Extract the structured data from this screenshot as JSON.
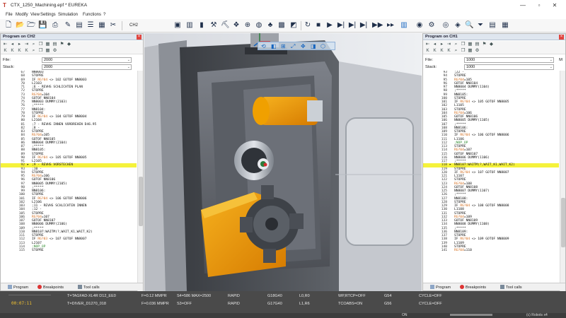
{
  "window": {
    "title": "CTX_1250_Machining.epf * EUREKA",
    "minimize": "—",
    "maximize": "▫",
    "close": "✕"
  },
  "menu": [
    "File",
    "Modify",
    "View",
    "Settings",
    "Simulation",
    "Functions",
    "?"
  ],
  "toolbar": {
    "channel_label": "CH2"
  },
  "left_panel": {
    "title": "Program on CH2",
    "file_label": "File:",
    "file_value": "2000",
    "stack_label": "Stack:",
    "stack_value": "2000",
    "lines": [
      {
        "n": "67",
        "t": "NN8003"
      },
      {
        "n": "68",
        "t": "STOPRE"
      },
      {
        "n": "69",
        "t": "IF RG?04 <> 102 GOTOF NN8003"
      },
      {
        "n": "70",
        "t": "L2103"
      },
      {
        "n": "71",
        "t": ";6 - REVHS SCHLICHTEN PLAN"
      },
      {
        "n": "72",
        "t": "STOPRE"
      },
      {
        "n": "73",
        "t": "RG?04=104"
      },
      {
        "n": "74",
        "t": "GOTOF NN8104"
      },
      {
        "n": "75",
        "t": "NN8003 DUMMY(2103)"
      },
      {
        "n": "76",
        "t": ";*****"
      },
      {
        "n": "77",
        "t": "NN8104:"
      },
      {
        "n": "78",
        "t": "STOPRE"
      },
      {
        "n": "79",
        "t": "IF RG?04 <> 104 GOTOF NN8004"
      },
      {
        "n": "80",
        "t": "L2104"
      },
      {
        "n": "81",
        "t": ";7 - REVHS INNEN VORDREHEN D46.95"
      },
      {
        "n": "82",
        "t": ";8 -"
      },
      {
        "n": "83",
        "t": "STOPRE"
      },
      {
        "n": "84",
        "t": "RG?04=105"
      },
      {
        "n": "85",
        "t": "GOTOF NN8105"
      },
      {
        "n": "86",
        "t": "NN8004 DUMMY(2104)"
      },
      {
        "n": "87",
        "t": ";*****"
      },
      {
        "n": "88",
        "t": "NN8105:"
      },
      {
        "n": "89",
        "t": "STOPRE"
      },
      {
        "n": "90",
        "t": "IF RG?04 <> 105 GOTOF NN8005"
      },
      {
        "n": "91",
        "t": "L2105"
      },
      {
        "n": "92",
        "t": ";9 - REVHS VORSTECHEN",
        "hl": true
      },
      {
        "n": "93",
        "t": ";10 -"
      },
      {
        "n": "94",
        "t": "STOPRE"
      },
      {
        "n": "95",
        "t": "RG?04=106"
      },
      {
        "n": "96",
        "t": "GOTOF NN8106"
      },
      {
        "n": "97",
        "t": "NN8005 DUMMY(2105)"
      },
      {
        "n": "98",
        "t": ";*****"
      },
      {
        "n": "99",
        "t": "NN8106:"
      },
      {
        "n": "100",
        "t": "STOPRE"
      },
      {
        "n": "101",
        "t": "IF RG?04 <> 106 GOTOF NN8006"
      },
      {
        "n": "102",
        "t": "L2106"
      },
      {
        "n": "103",
        "t": ";11 - REVHS SCHLICHTEN INNEN"
      },
      {
        "n": "104",
        "t": ";12 -"
      },
      {
        "n": "105",
        "t": "STOPRE"
      },
      {
        "n": "106",
        "t": "RG?04=107"
      },
      {
        "n": "107",
        "t": "GOTOF NN8107"
      },
      {
        "n": "108",
        "t": "NN8006 DUMMY(2106)"
      },
      {
        "n": "109",
        "t": ";*****"
      },
      {
        "n": "110",
        "t": "NN8107:WAITM(?,WAIT_K1,WAIT_K2)"
      },
      {
        "n": "111",
        "t": "STOPRE"
      },
      {
        "n": "112",
        "t": "IF RG?03 <> 107 GOTOF NN8007"
      },
      {
        "n": "113",
        "t": "L2107"
      },
      {
        "n": "114",
        "t": ";NOP_OP"
      },
      {
        "n": "115",
        "t": "STOPRE"
      }
    ],
    "tabs": [
      "Program",
      "Breakpoints",
      "Tool calls"
    ]
  },
  "right_panel": {
    "title": "Program on CH1",
    "file_label": "File:",
    "file_value": "1000",
    "stack_label": "Stack:",
    "stack_value": "1000",
    "extra_label": "M",
    "lines": [
      {
        "n": "93",
        "t": ";22 -"
      },
      {
        "n": "94",
        "t": "STOPRE"
      },
      {
        "n": "95",
        "t": "RG?04=105"
      },
      {
        "n": "96",
        "t": "GOTOF NN8104"
      },
      {
        "n": "97",
        "t": "NN8004 DUMMY(1104)"
      },
      {
        "n": "98",
        "t": ";*****"
      },
      {
        "n": "99",
        "t": "NN8105:"
      },
      {
        "n": "100",
        "t": "STOPRE"
      },
      {
        "n": "101",
        "t": "IF RG?04 <> 105 GOTOF NN8005"
      },
      {
        "n": "102",
        "t": "L1105"
      },
      {
        "n": "103",
        "t": "STOPRE"
      },
      {
        "n": "104",
        "t": "RG?04=106"
      },
      {
        "n": "105",
        "t": "GOTOF NN8106"
      },
      {
        "n": "106",
        "t": "NN8005 DUMMY(1105)"
      },
      {
        "n": "107",
        "t": ";*****"
      },
      {
        "n": "108",
        "t": "NN8106:"
      },
      {
        "n": "109",
        "t": "STOPRE"
      },
      {
        "n": "110",
        "t": "IF RG?04 <> 106 GOTOF NN8006"
      },
      {
        "n": "111",
        "t": "L1106"
      },
      {
        "n": "112",
        "t": ";NOP_OP"
      },
      {
        "n": "113",
        "t": "STOPRE"
      },
      {
        "n": "114",
        "t": "RG?04=107"
      },
      {
        "n": "115",
        "t": "GOTOF NN8107"
      },
      {
        "n": "116",
        "t": "NN8006 DUMMY(1106)"
      },
      {
        "n": "117",
        "t": ";*****"
      },
      {
        "n": "118",
        "t": "NN8107:WAITM(?,WAIT_K1,WAIT_K2)",
        "hl": true
      },
      {
        "n": "119",
        "t": "STOPRE"
      },
      {
        "n": "120",
        "t": "IF RG?04 <> 107 GOTOF NN8007"
      },
      {
        "n": "121",
        "t": "L1107"
      },
      {
        "n": "122",
        "t": "STOPRE"
      },
      {
        "n": "123",
        "t": "RG?04=108"
      },
      {
        "n": "124",
        "t": "GOTOF NN8108"
      },
      {
        "n": "125",
        "t": "NN8007 DUMMY(1107)"
      },
      {
        "n": "126",
        "t": ";*****"
      },
      {
        "n": "127",
        "t": "NN8108:"
      },
      {
        "n": "128",
        "t": "STOPRE"
      },
      {
        "n": "129",
        "t": "IF RG?04 <> 108 GOTOF NN8008"
      },
      {
        "n": "130",
        "t": "L1108"
      },
      {
        "n": "131",
        "t": "STOPRE"
      },
      {
        "n": "132",
        "t": "RG?04=109"
      },
      {
        "n": "133",
        "t": "GOTOF NN8109"
      },
      {
        "n": "134",
        "t": "NN8008 DUMMY(1108)"
      },
      {
        "n": "135",
        "t": ";*****"
      },
      {
        "n": "136",
        "t": "NN8109:"
      },
      {
        "n": "137",
        "t": "STOPRE"
      },
      {
        "n": "138",
        "t": "IF RG?04 <> 109 GOTOF NN8009"
      },
      {
        "n": "139",
        "t": "L1109"
      },
      {
        "n": "140",
        "t": "STOPRE"
      },
      {
        "n": "141",
        "t": "RG?04=110"
      }
    ],
    "tabs": [
      "Program",
      "Breakpoints",
      "Tool calls"
    ]
  },
  "status": {
    "time": "00:07:11",
    "row1": {
      "tool": "T=TAGFAD-XL4R D12_EE0",
      "feed": "F=0.12 MMPR",
      "speed": "S4=586 MAX=2500",
      "mode": "RAPID",
      "g1": "G18G40",
      "g2": "L0,R0",
      "wp": "WP,RTCP=OFF",
      "g54": "G54",
      "cycle": "CYCLE=OFF"
    },
    "row2": {
      "tool": "T=DIVER_D1270_018",
      "feed": "F=0.036 MMPR",
      "speed": "S3=OFF",
      "mode": "RAPID",
      "g1": "G17G40",
      "g2": "L1,R6",
      "wp": "TCOABS=ON",
      "g54": "G56",
      "cycle": "CYCLE=OFF"
    },
    "bottom": {
      "on": "ON",
      "zoom": "(c) Robots x4"
    }
  },
  "colors": {
    "accent_blue": "#1565c0",
    "highlight_yellow": "#f5f23b",
    "part_orange": "#f0a000",
    "status_time": "#f3c230"
  }
}
